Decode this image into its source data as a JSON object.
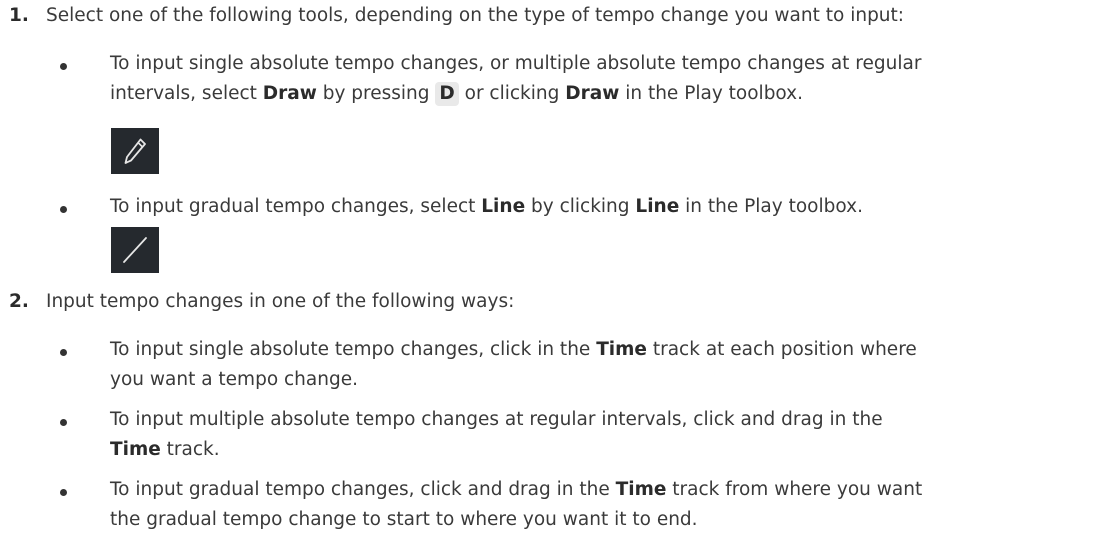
{
  "steps": [
    {
      "number": "1.",
      "text": "Select one of the following tools, depending on the type of tempo change you want to input:",
      "bullets": [
        {
          "line1": "To input single absolute tempo changes, or multiple absolute tempo changes at regular",
          "line2_a": "intervals, select ",
          "line2_b1": "Draw",
          "line2_c": " by pressing ",
          "key": "D",
          "line2_d": " or clicking ",
          "line2_b2": "Draw",
          "line2_e": " in the Play toolbox.",
          "icon": "pencil-icon"
        },
        {
          "a": "To input gradual tempo changes, select ",
          "b1": "Line",
          "c": " by clicking ",
          "b2": "Line",
          "d": " in the Play toolbox.",
          "icon": "line-tool-icon"
        }
      ]
    },
    {
      "number": "2.",
      "text": "Input tempo changes in one of the following ways:",
      "bullets": [
        {
          "a": "To input single absolute tempo changes, click in the ",
          "b": "Time",
          "c": " track at each position where",
          "line2": "you want a tempo change."
        },
        {
          "line1": "To input multiple absolute tempo changes at regular intervals, click and drag in the",
          "b": "Time",
          "c": " track."
        },
        {
          "a": "To input gradual tempo changes, click and drag in the ",
          "b": "Time",
          "c": " track from where you want",
          "line2": "the gradual tempo change to start to where you want it to end."
        }
      ]
    }
  ],
  "colors": {
    "text": "#3a3a3a",
    "bold": "#2b2b2b",
    "icon_bg": "#25292e",
    "icon_stroke": "#e6e6e6",
    "kbd_bg": "#e9e9e9"
  }
}
